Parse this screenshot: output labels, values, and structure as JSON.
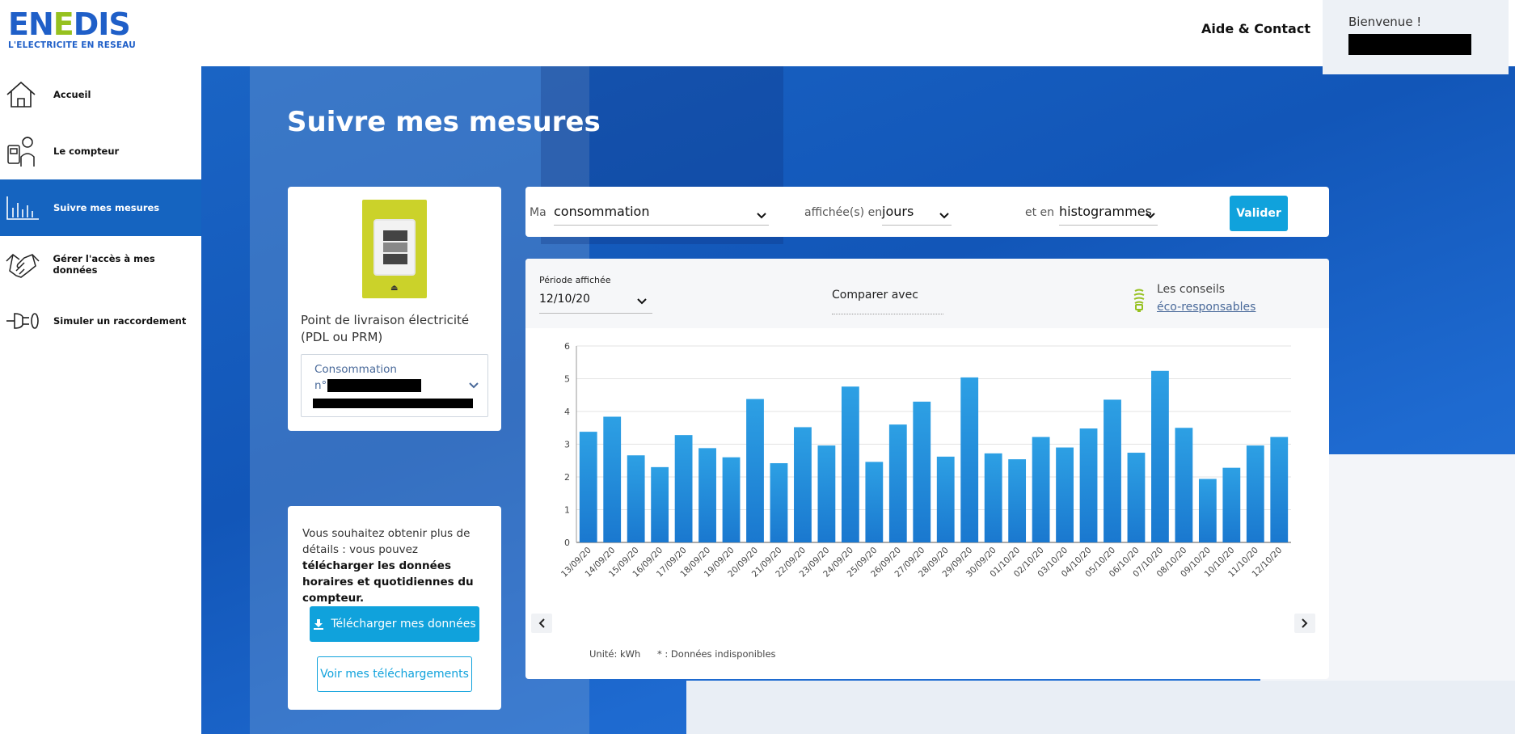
{
  "header": {
    "logo_word_a": "EN",
    "logo_word_b": "E",
    "logo_word_c": "DIS",
    "logo_tagline": "L'ELECTRICITE EN RESEAU",
    "help": "Aide & Contact",
    "welcome": "Bienvenue !"
  },
  "sidebar": {
    "items": [
      {
        "label": "Accueil",
        "icon": "house-icon"
      },
      {
        "label": "Le compteur",
        "icon": "technician-icon"
      },
      {
        "label": "Suivre mes mesures",
        "icon": "bar-chart-icon"
      },
      {
        "label": "Gérer l'accès à mes données",
        "icon": "handshake-icon"
      },
      {
        "label": "Simuler un raccordement",
        "icon": "plug-icon"
      }
    ],
    "active_index": 2
  },
  "page": {
    "title": "Suivre mes mesures"
  },
  "meter_card": {
    "label": "Point de livraison électricité (PDL ou PRM)",
    "select_label": "Consommation",
    "select_prefix": "n°"
  },
  "download_card": {
    "text_plain": "Vous souhaitez obtenir plus de détails : vous pouvez ",
    "text_bold": "télécharger les données horaires et quotidiennes du compteur.",
    "download_button": "Télécharger mes données",
    "view_button": "Voir mes téléchargements"
  },
  "filters": {
    "ma": "Ma",
    "measure": "consommation",
    "displayed_in": "affichée(s) en",
    "granularity": "jours",
    "and_in": "et en",
    "chart_type": "histogrammes",
    "submit": "Valider"
  },
  "chart_panel": {
    "period_label": "Période affichée",
    "period_value": "12/10/20",
    "compare": "Comparer avec",
    "tips_1": "Les conseils",
    "tips_2": "éco-responsables",
    "unit": "Unité: kWh",
    "unavailable": "* : Données indisponibles"
  },
  "colors": {
    "brand_blue": "#1f5fc8",
    "brand_green": "#96c11f",
    "accent": "#10a2dc",
    "bar": "#1a78cf",
    "bar_light": "#2da0e4"
  },
  "chart_data": {
    "type": "bar",
    "title": "",
    "xlabel": "",
    "ylabel": "",
    "ylim": [
      0,
      6
    ],
    "yticks": [
      0,
      1,
      2,
      3,
      4,
      5,
      6
    ],
    "grid": true,
    "categories": [
      "13/09/20",
      "14/09/20",
      "15/09/20",
      "16/09/20",
      "17/09/20",
      "18/09/20",
      "19/09/20",
      "20/09/20",
      "21/09/20",
      "22/09/20",
      "23/09/20",
      "24/09/20",
      "25/09/20",
      "26/09/20",
      "27/09/20",
      "28/09/20",
      "29/09/20",
      "30/09/20",
      "01/10/20",
      "02/10/20",
      "03/10/20",
      "04/10/20",
      "05/10/20",
      "06/10/20",
      "07/10/20",
      "08/10/20",
      "09/10/20",
      "10/10/20",
      "11/10/20",
      "12/10/20"
    ],
    "values": [
      3.38,
      3.84,
      2.66,
      2.3,
      3.28,
      2.88,
      2.6,
      4.38,
      2.42,
      3.52,
      2.96,
      4.76,
      2.46,
      3.6,
      4.3,
      2.62,
      5.04,
      2.72,
      2.54,
      3.22,
      2.9,
      3.48,
      4.36,
      2.74,
      5.24,
      3.5,
      1.94,
      2.28,
      2.96,
      3.22
    ]
  }
}
